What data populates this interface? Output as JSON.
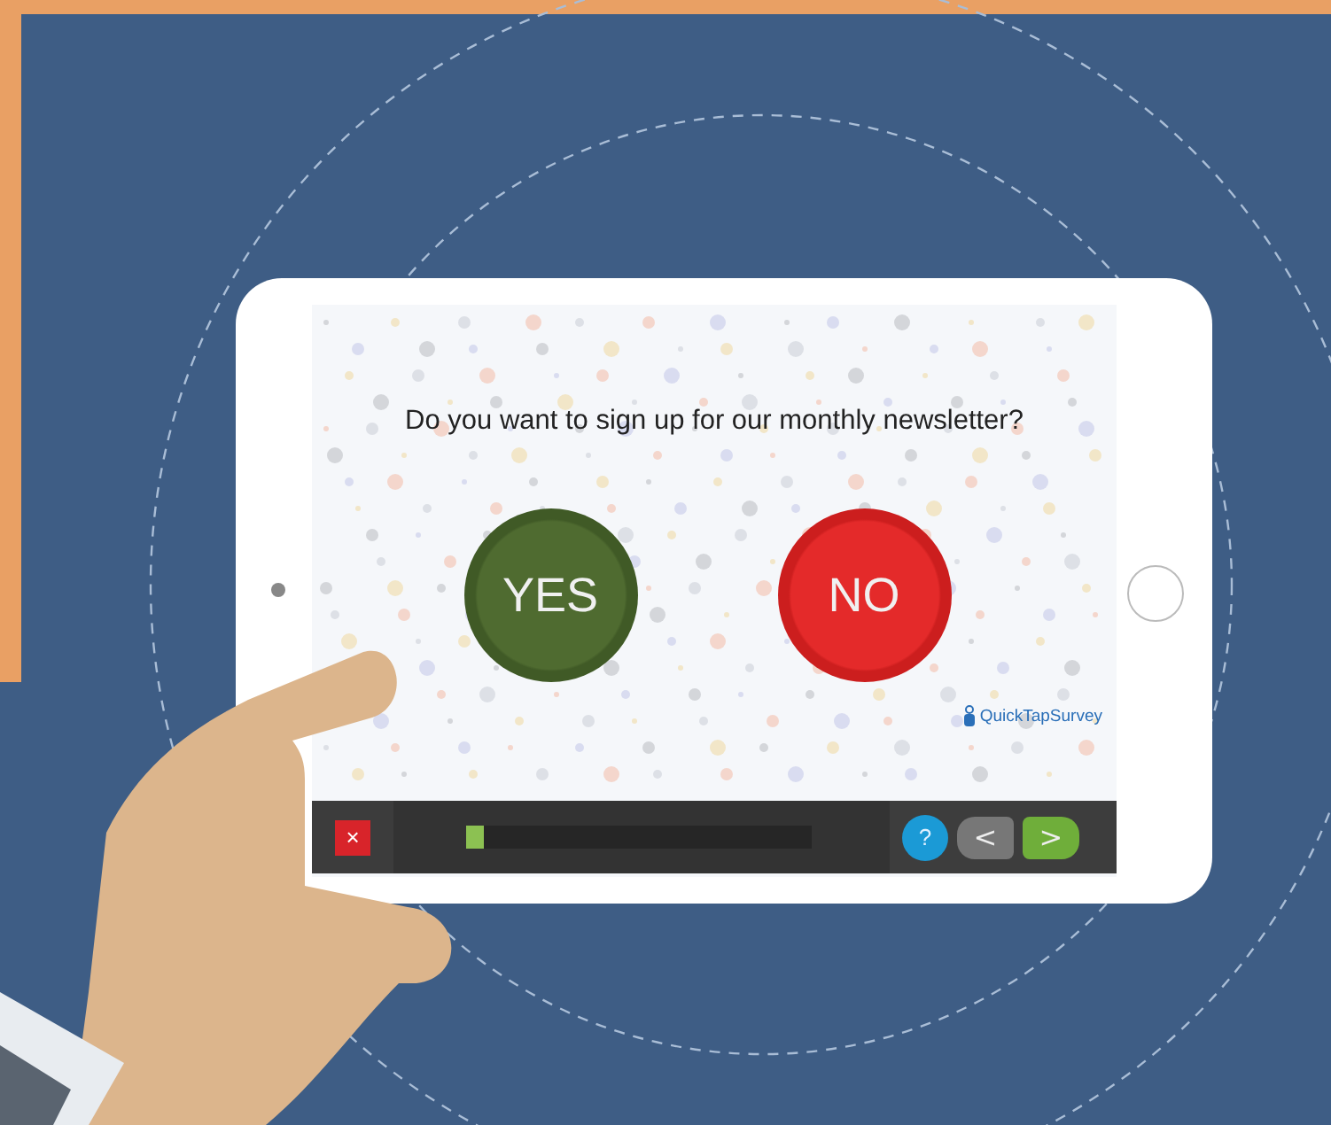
{
  "survey": {
    "question": "Do you want to sign up for our monthly newsletter?",
    "answers": [
      {
        "label": "YES",
        "kind": "yes"
      },
      {
        "label": "NO",
        "kind": "no"
      }
    ],
    "brand": "QuickTapSurvey"
  },
  "toolbar": {
    "close": "×",
    "progress": {
      "level": 0.05
    },
    "help": "?",
    "back": "<",
    "next": ">"
  }
}
